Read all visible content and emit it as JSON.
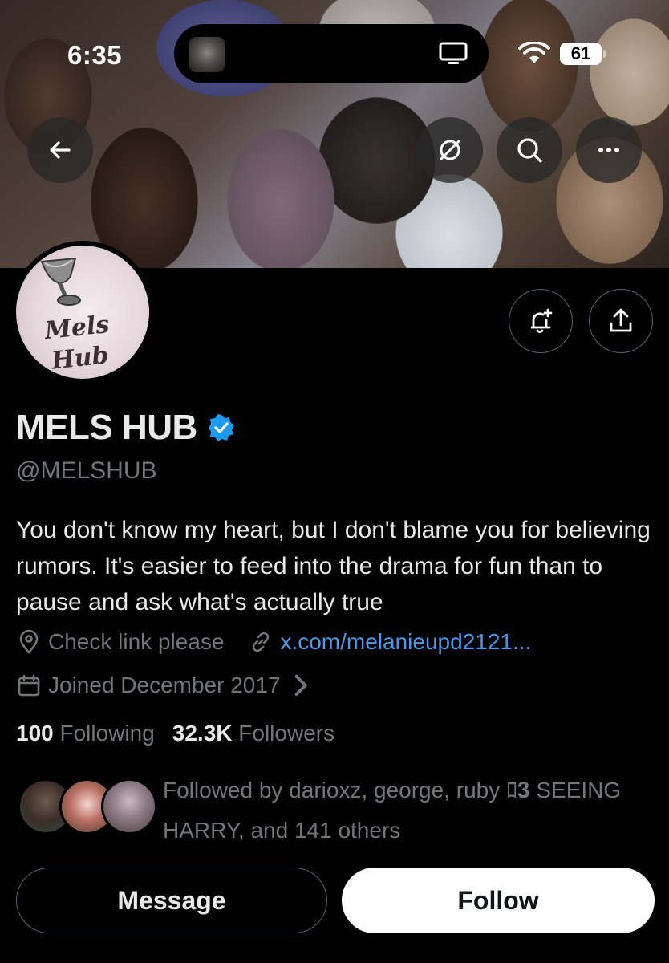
{
  "status_bar": {
    "time": "6:35",
    "battery": "61"
  },
  "banner_buttons": {
    "back": "back-arrow-icon",
    "grok": "grok-slash-icon",
    "search": "search-icon",
    "more": "more-dots-icon"
  },
  "avatar": {
    "line1": "Mels",
    "line2": "Hub"
  },
  "profile": {
    "name": "MELS HUB",
    "handle": "@MELSHUB",
    "bio": "You don't know my heart, but I don't blame you for believing rumors. It's easier to feed into the drama for fun than to pause and ask what's actually true",
    "location": "Check link please",
    "website": "x.com/melanieupd2121...",
    "joined": "Joined December 2017",
    "following_count": "100",
    "following_label": "Following",
    "followers_count": "32.3K",
    "followers_label": "Followers",
    "followed_by": "Followed by darioxz, george, ruby ﾛ𝟑 SEEING HARRY, and 141 others"
  },
  "actions": {
    "message_label": "Message",
    "follow_label": "Follow"
  },
  "colors": {
    "background": "#000000",
    "link": "#4a99e9",
    "verified": "#1d9bf0",
    "secondary_text": "#71767b"
  }
}
